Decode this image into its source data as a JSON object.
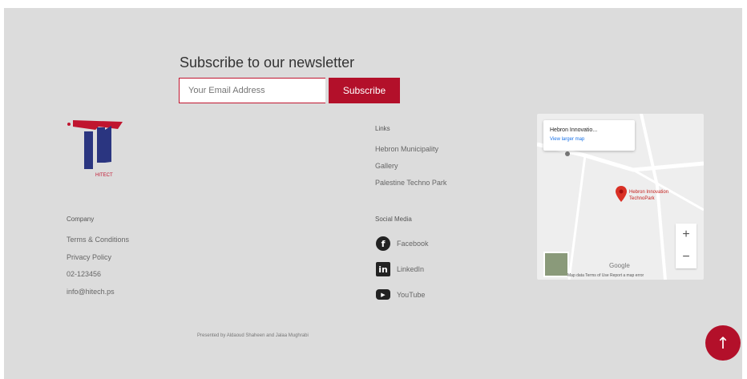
{
  "newsletter": {
    "title": "Subscribe to our newsletter",
    "placeholder": "Your Email Address",
    "button": "Subscribe"
  },
  "logo": {
    "text": "HITECT"
  },
  "company": {
    "heading": "Company",
    "links": [
      "Terms & Conditions",
      "Privacy Policy",
      "02-123456",
      "info@hitech.ps"
    ]
  },
  "links": {
    "heading": "Links",
    "items": [
      "Hebron Municipality",
      "Gallery",
      "Palestine Techno Park"
    ]
  },
  "social": {
    "heading": "Social Media",
    "items": [
      {
        "label": "Facebook",
        "icon": "facebook-icon"
      },
      {
        "label": "LinkedIn",
        "icon": "linkedin-icon"
      },
      {
        "label": "YouTube",
        "icon": "youtube-icon"
      }
    ]
  },
  "map": {
    "card_title": "Hebron Innovatio...",
    "card_link": "View larger map",
    "place_label": "Hebron Innovation TechnoPark",
    "google": "Google",
    "attribution": "Map data   Terms of Use   Report a map error",
    "zoom_in": "+",
    "zoom_out": "−"
  },
  "credit": "Presented by Aldaoud Shaheen and Jalaa Mughrabi",
  "to_top": "↑",
  "colors": {
    "accent": "#b3102a",
    "background": "#dcdcdc"
  }
}
